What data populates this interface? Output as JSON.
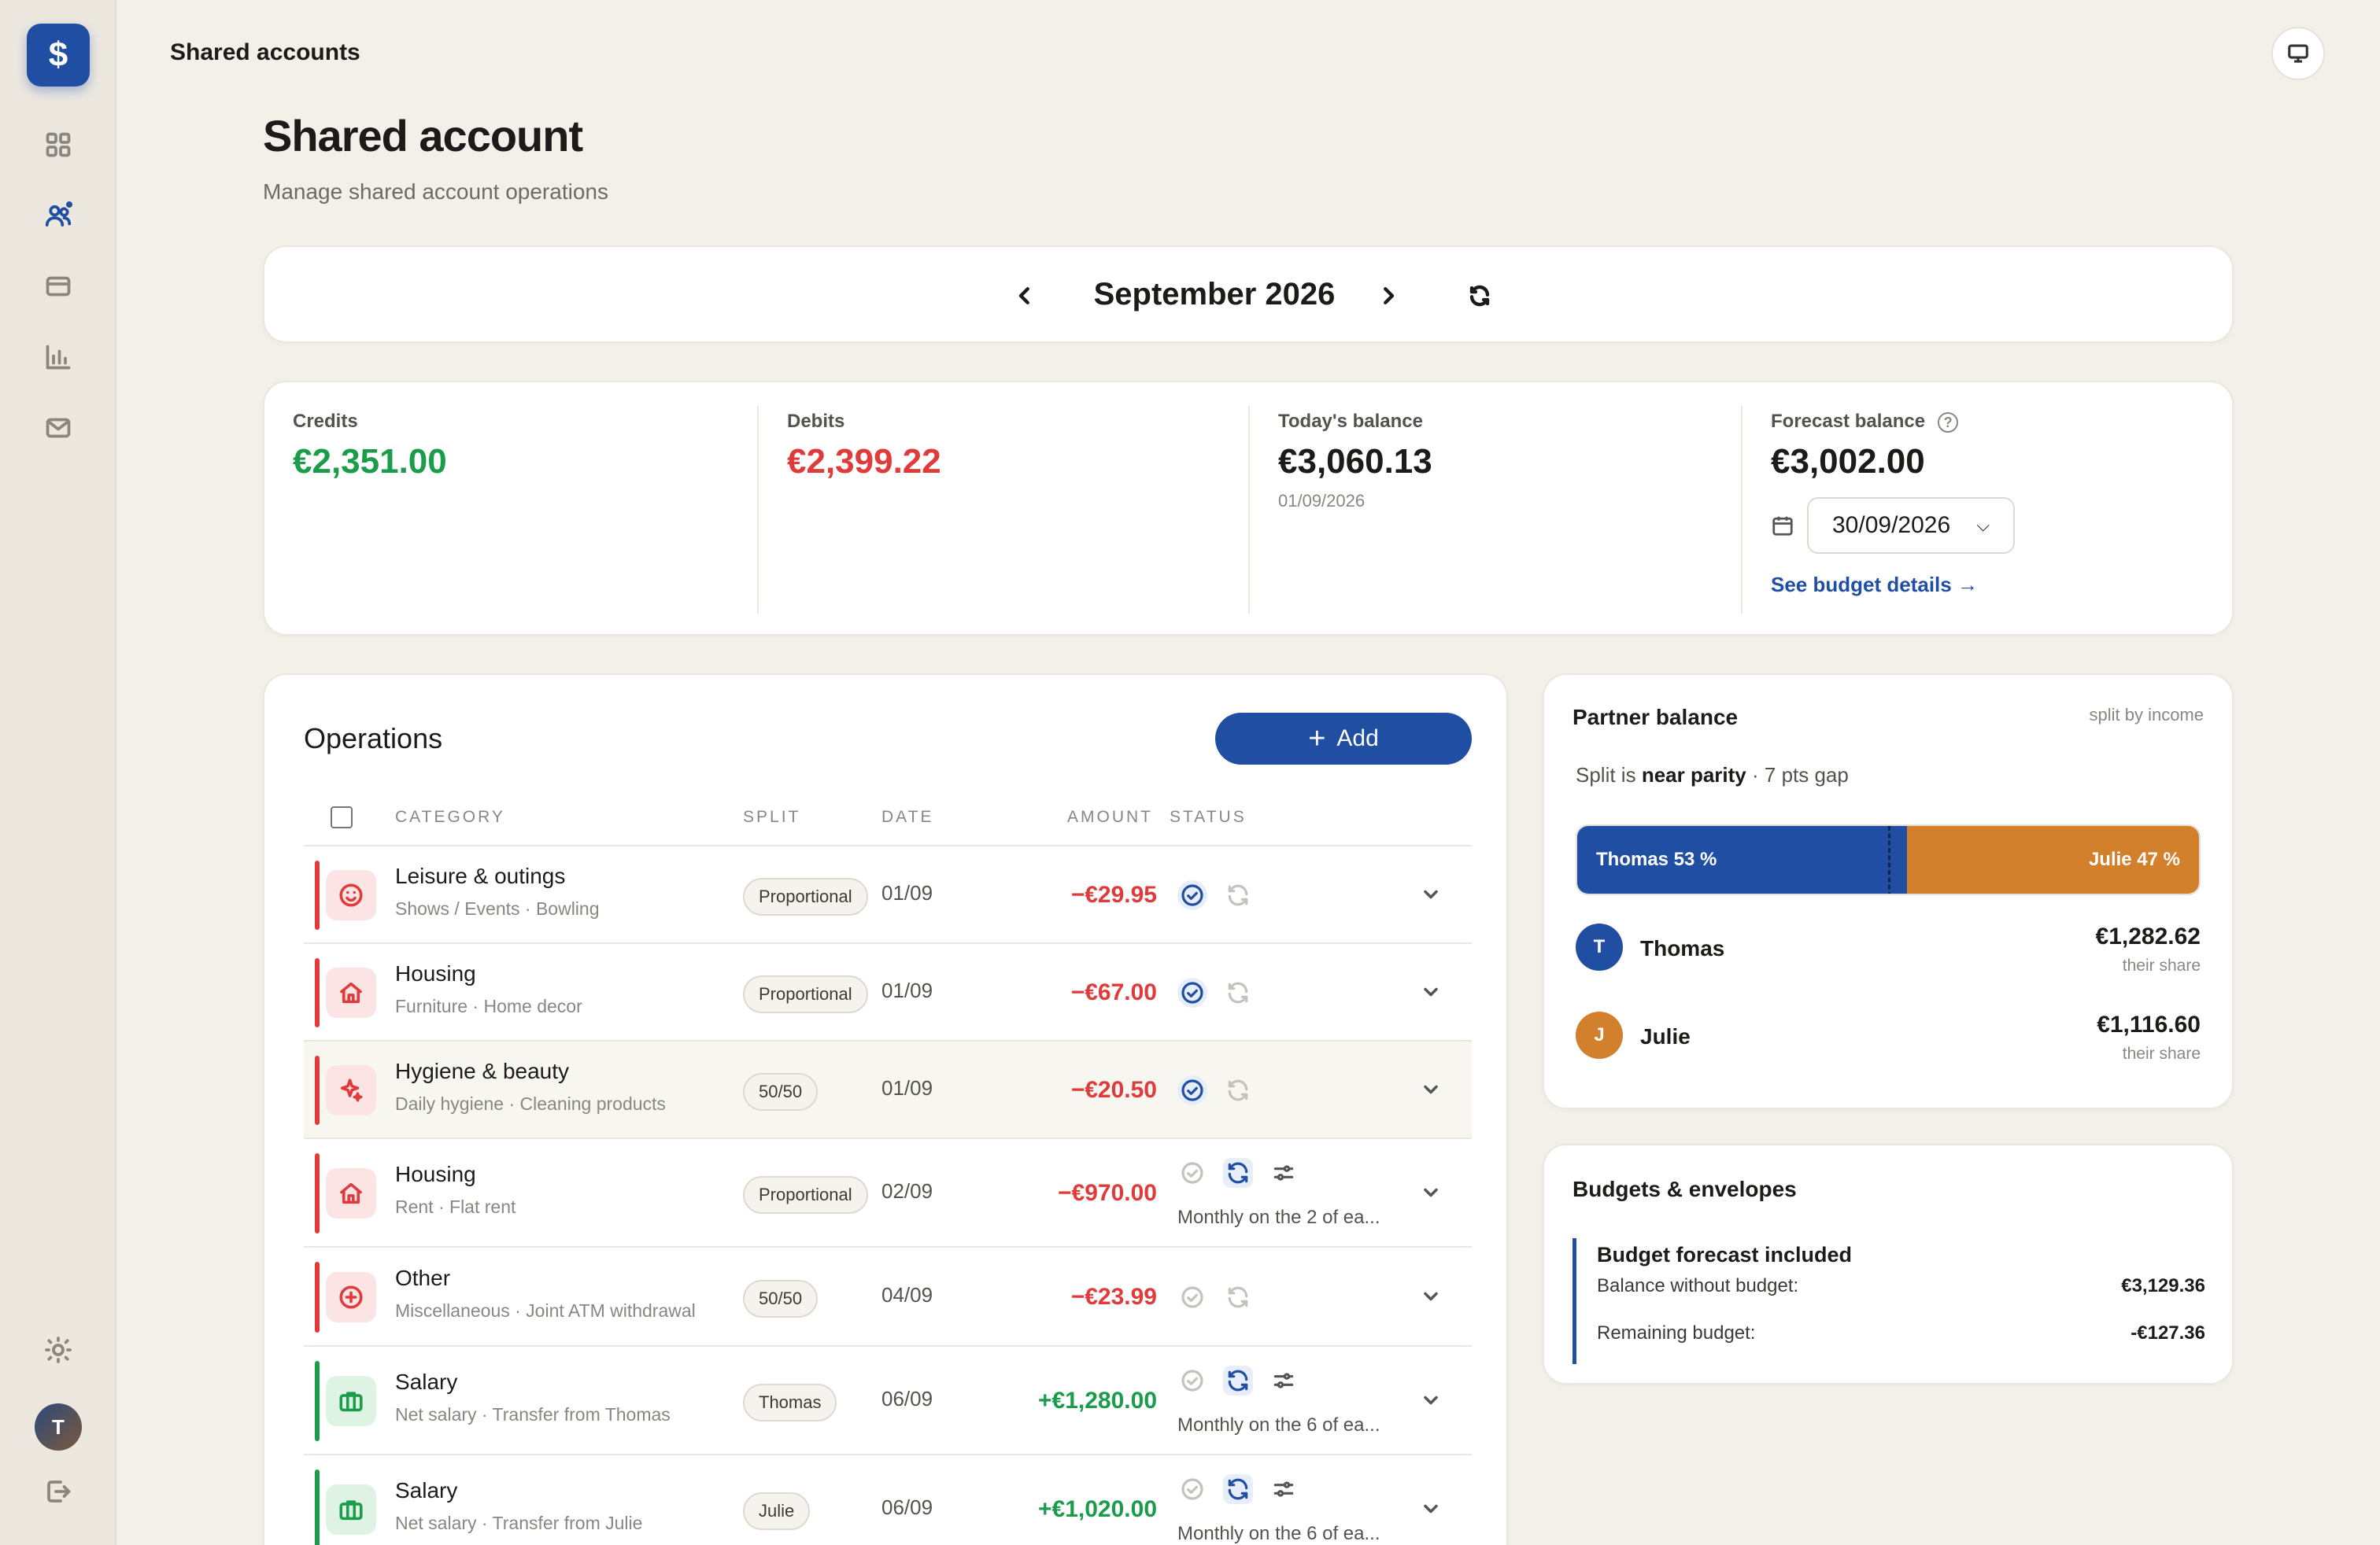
{
  "app": {
    "logo_symbol": "$",
    "header_title": "Shared accounts",
    "brand_color": "#1f4ea3"
  },
  "sidebar": {
    "items": [
      {
        "name": "dashboard",
        "icon": "grid-icon",
        "active": false
      },
      {
        "name": "shared-accounts",
        "icon": "users-icon",
        "active": true,
        "has_notification": true
      },
      {
        "name": "accounts",
        "icon": "wallet-icon",
        "active": false
      },
      {
        "name": "statistics",
        "icon": "bar-chart-icon",
        "active": false
      },
      {
        "name": "messages",
        "icon": "mail-icon",
        "active": false
      }
    ],
    "settings_icon": "sun-icon",
    "user_initial": "T",
    "logout_icon": "logout-icon"
  },
  "page": {
    "title": "Shared account",
    "subtitle": "Manage shared account operations"
  },
  "month_nav": {
    "label": "September 2026"
  },
  "summary": {
    "credits": {
      "label": "Credits",
      "value": "€2,351.00"
    },
    "debits": {
      "label": "Debits",
      "value": "€2,399.22"
    },
    "today": {
      "label": "Today's balance",
      "value": "€3,060.13",
      "date": "01/09/2026"
    },
    "forecast": {
      "label": "Forecast balance",
      "help": "?",
      "value": "€3,002.00",
      "date": "30/09/2026",
      "link": "See budget details →"
    }
  },
  "operations": {
    "title": "Operations",
    "add_label": "Add",
    "columns": {
      "category": "CATEGORY",
      "split": "SPLIT",
      "date": "DATE",
      "amount": "AMOUNT",
      "status": "STATUS"
    },
    "rows": [
      {
        "name": "Leisure & outings",
        "sub": "Shows / Events · Bowling",
        "split": "Proportional",
        "date": "01/09",
        "amount": "−€29.95",
        "type": "debit",
        "icon": "smile-icon",
        "status": [
          "checked",
          "recurring-off"
        ],
        "recurrence": ""
      },
      {
        "name": "Housing",
        "sub": "Furniture · Home decor",
        "split": "Proportional",
        "date": "01/09",
        "amount": "−€67.00",
        "type": "debit",
        "icon": "home-icon",
        "status": [
          "checked",
          "recurring-off"
        ],
        "recurrence": ""
      },
      {
        "name": "Hygiene & beauty",
        "sub": "Daily hygiene · Cleaning products",
        "split": "50/50",
        "date": "01/09",
        "amount": "−€20.50",
        "type": "debit",
        "icon": "sparkle-icon",
        "status": [
          "checked",
          "recurring-off"
        ],
        "recurrence": "",
        "highlight": true
      },
      {
        "name": "Housing",
        "sub": "Rent · Flat rent",
        "split": "Proportional",
        "date": "02/09",
        "amount": "−€970.00",
        "type": "debit",
        "icon": "home-icon",
        "status": [
          "unchecked",
          "recurring-on",
          "adjust"
        ],
        "recurrence": "Monthly on the 2 of ea..."
      },
      {
        "name": "Other",
        "sub": "Miscellaneous · Joint ATM withdrawal",
        "split": "50/50",
        "date": "04/09",
        "amount": "−€23.99",
        "type": "debit",
        "icon": "plus-circle-icon",
        "status": [
          "unchecked",
          "recurring-off"
        ],
        "recurrence": ""
      },
      {
        "name": "Salary",
        "sub": "Net salary · Transfer from Thomas",
        "split": "Thomas",
        "date": "06/09",
        "amount": "+€1,280.00",
        "type": "credit",
        "icon": "briefcase-icon",
        "status": [
          "unchecked",
          "recurring-on",
          "adjust"
        ],
        "recurrence": "Monthly on the 6 of ea..."
      },
      {
        "name": "Salary",
        "sub": "Net salary · Transfer from Julie",
        "split": "Julie",
        "date": "06/09",
        "amount": "+€1,020.00",
        "type": "credit",
        "icon": "briefcase-icon",
        "status": [
          "unchecked",
          "recurring-on",
          "adjust"
        ],
        "recurrence": "Monthly on the 6 of ea..."
      }
    ]
  },
  "partner_balance": {
    "title": "Partner balance",
    "mode": "split by income",
    "parity_prefix": "Split is",
    "parity_status": "near parity",
    "parity_gap": "· 7 pts gap",
    "share_a": {
      "label": "Thomas 53 %",
      "percent": 53,
      "color": "#1f4ea3"
    },
    "share_b": {
      "label": "Julie 47 %",
      "percent": 47,
      "color": "#d2802c"
    },
    "partners": [
      {
        "initial": "T",
        "name": "Thomas",
        "amount": "€1,282.62",
        "note": "their share",
        "color": "#1f4ea3"
      },
      {
        "initial": "J",
        "name": "Julie",
        "amount": "€1,116.60",
        "note": "their share",
        "color": "#d2802c"
      }
    ]
  },
  "budgets": {
    "title": "Budgets & envelopes",
    "box_title": "Budget forecast included",
    "lines": [
      {
        "label": "Balance without budget:",
        "value": "€3,129.36"
      },
      {
        "label": "Remaining budget:",
        "value": "-€127.36"
      }
    ]
  }
}
